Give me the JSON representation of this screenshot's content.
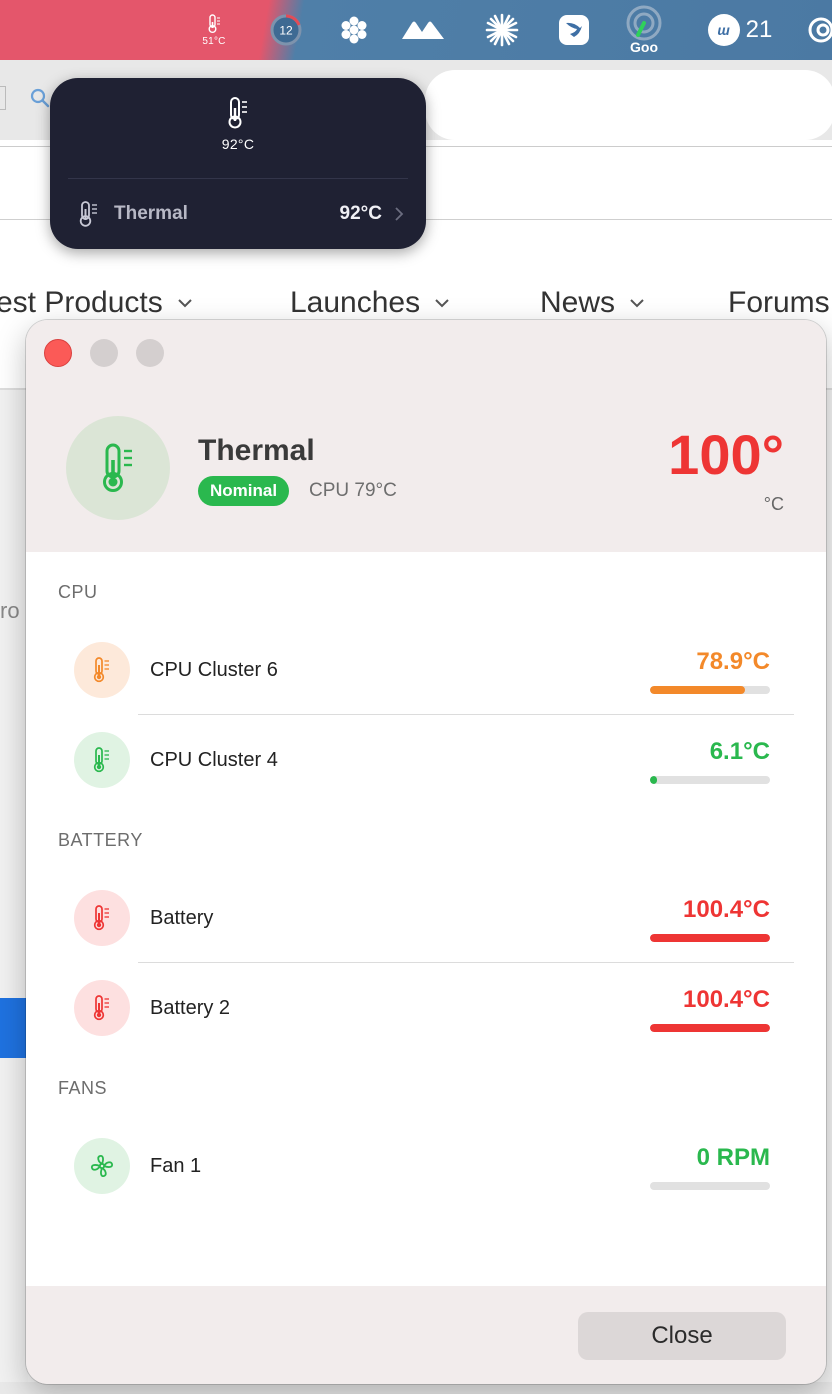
{
  "menubar": {
    "temp_widget": {
      "icon": "thermometer-icon",
      "text": "51°C"
    },
    "ring_widget": {
      "number": "12"
    },
    "goo_widget": {
      "text": "Goo"
    },
    "badge_widget": {
      "logo": "ш",
      "count": "21"
    }
  },
  "browser": {
    "nav": [
      "est Products",
      "Launches",
      "News",
      "Forums"
    ],
    "side_text": "ro"
  },
  "popover": {
    "top_value": "92°C",
    "row_label": "Thermal",
    "row_value": "92°C"
  },
  "window": {
    "header": {
      "title": "Thermal",
      "badge": "Nominal",
      "subtitle": "CPU 79°C",
      "big_value": "100°",
      "unit": "°C"
    },
    "sections": [
      {
        "title": "CPU",
        "items": [
          {
            "label": "CPU Cluster 6",
            "value": "78.9°C",
            "level": 0.79,
            "color": "#f3892a",
            "icon_bg": "#fde9da",
            "icon": "thermometer-icon"
          },
          {
            "label": "CPU Cluster 4",
            "value": "6.1°C",
            "level": 0.06,
            "color": "#2ab84e",
            "icon_bg": "#e0f3e3",
            "icon": "thermometer-icon"
          }
        ]
      },
      {
        "title": "BATTERY",
        "items": [
          {
            "label": "Battery",
            "value": "100.4°C",
            "level": 1.0,
            "color": "#ee3534",
            "icon_bg": "#fde0e0",
            "icon": "thermometer-icon"
          },
          {
            "label": "Battery 2",
            "value": "100.4°C",
            "level": 1.0,
            "color": "#ee3534",
            "icon_bg": "#fde0e0",
            "icon": "thermometer-icon"
          }
        ]
      },
      {
        "title": "FANS",
        "items": [
          {
            "label": "Fan 1",
            "value": "0 RPM",
            "level": 0.0,
            "color": "#2ab84e",
            "icon_bg": "#e0f3e3",
            "icon": "fan-icon"
          }
        ]
      }
    ],
    "footer": {
      "close_label": "Close"
    }
  },
  "colors": {
    "accent_green": "#2ab84e",
    "accent_red": "#ee3534",
    "accent_orange": "#f3892a"
  }
}
